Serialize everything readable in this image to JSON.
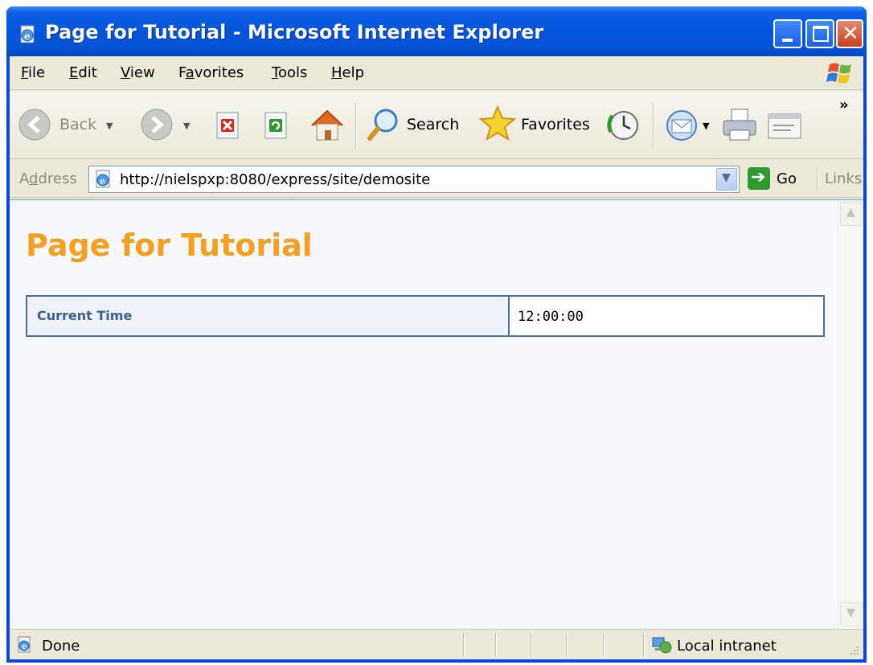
{
  "window": {
    "title": "Page for Tutorial - Microsoft Internet Explorer"
  },
  "menu": {
    "items": [
      {
        "label": "File",
        "accel": "F",
        "rest": "ile"
      },
      {
        "label": "Edit",
        "accel": "E",
        "rest": "dit"
      },
      {
        "label": "View",
        "accel": "V",
        "rest": "iew"
      },
      {
        "label": "Favorites",
        "pre": "F",
        "accel": "a",
        "rest": "vorites"
      },
      {
        "label": "Tools",
        "accel": "T",
        "rest": "ools"
      },
      {
        "label": "Help",
        "accel": "H",
        "rest": "elp"
      }
    ]
  },
  "toolbar": {
    "back_label": "Back",
    "search_label": "Search",
    "favorites_label": "Favorites",
    "overflow": "»"
  },
  "address": {
    "label": "Address",
    "label_pre": "A",
    "label_accel": "d",
    "label_rest": "dress",
    "url": "http://nielspxp:8080/express/site/demosite",
    "go_label": "Go",
    "links_label": "Links"
  },
  "page": {
    "title": "Page for Tutorial",
    "table": {
      "label": "Current Time",
      "value": "12:00:00"
    }
  },
  "status": {
    "text": "Done",
    "zone": "Local intranet"
  },
  "colors": {
    "title_orange": "#f5a020",
    "table_border": "#4a6fa6",
    "xp_blue": "#0554de"
  }
}
